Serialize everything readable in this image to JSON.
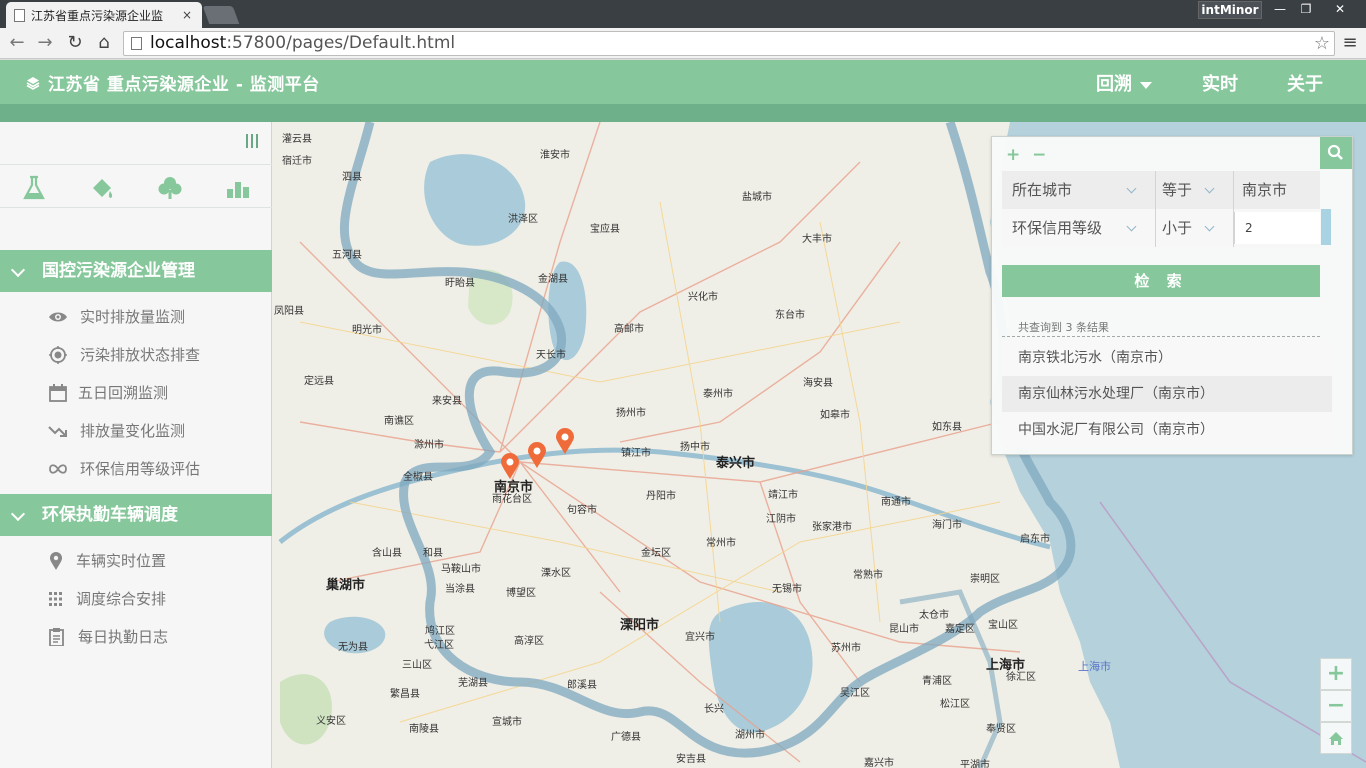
{
  "browser": {
    "tab_title": "江苏省重点污染源企业监",
    "tab_close": "×",
    "user_badge": "intMinor",
    "win_min": "—",
    "win_max": "❐",
    "win_close": "✕",
    "url_host": "localhost",
    "url_path": ":57800/pages/Default.html",
    "star": "☆",
    "menu": "≡",
    "back": "←",
    "forward": "→",
    "reload": "↻",
    "home": "⌂"
  },
  "header": {
    "brand": "江苏省 重点污染源企业 - 监测平台",
    "nav": {
      "huisu": "回溯",
      "shishi": "实时",
      "guanyu": "关于"
    }
  },
  "sidebar": {
    "sections": [
      {
        "title": "国控污染源企业管理",
        "items": [
          {
            "label": "实时排放量监测",
            "icon": "eye-icon"
          },
          {
            "label": "污染排放状态排查",
            "icon": "target-icon"
          },
          {
            "label": "五日回溯监测",
            "icon": "calendar-icon"
          },
          {
            "label": "排放量变化监测",
            "icon": "trend-down-icon"
          },
          {
            "label": "环保信用等级评估",
            "icon": "infinity-icon"
          }
        ]
      },
      {
        "title": "环保执勤车辆调度",
        "items": [
          {
            "label": "车辆实时位置",
            "icon": "map-pin-icon"
          },
          {
            "label": "调度综合安排",
            "icon": "grid-dots-icon"
          },
          {
            "label": "每日执勤日志",
            "icon": "clipboard-icon"
          }
        ]
      }
    ],
    "tools": [
      "flask-icon",
      "paint-bucket-icon",
      "tree-icon",
      "bar-chart-icon"
    ]
  },
  "query": {
    "plus": "+",
    "minus": "−",
    "rows": [
      {
        "field": "所在城市",
        "op": "等于",
        "value": "南京市"
      },
      {
        "field": "环保信用等级",
        "op": "小于",
        "value": "2"
      }
    ],
    "submit": "检 索",
    "count_text": "共查询到 3 条结果",
    "results": [
      "南京铁北污水（南京市）",
      "南京仙林污水处理厂（南京市）",
      "中国水泥厂有限公司（南京市）"
    ]
  },
  "map_controls": {
    "zoom_in": "+",
    "zoom_out": "−"
  },
  "map": {
    "labels": [
      "宿迁市",
      "灌云县",
      "淮安市",
      "盐城市",
      "泗县",
      "洪泽区",
      "宝应县",
      "大丰市",
      "五河县",
      "盱眙县",
      "金湖县",
      "兴化市",
      "东台市",
      "凤阳县",
      "明光市",
      "高邮市",
      "天长市",
      "定远县",
      "来安县",
      "泰州市",
      "海安县",
      "扬州市",
      "如皋市",
      "南谯区",
      "滁州市",
      "镇江市",
      "扬中市",
      "泰兴市",
      "如东县",
      "全椒县",
      "南京市",
      "雨花台区",
      "丹阳市",
      "靖江市",
      "南通市",
      "句容市",
      "江阴市",
      "张家港市",
      "海门市",
      "启东市",
      "含山县",
      "和县",
      "金坛区",
      "常州市",
      "常熟市",
      "崇明区",
      "巢湖市",
      "马鞍山市",
      "当涂县",
      "溧水区",
      "博望区",
      "无锡市",
      "太仓市",
      "宝山区",
      "鸠江区",
      "弋江区",
      "高淳区",
      "溧阳市",
      "宜兴市",
      "苏州市",
      "昆山市",
      "嘉定区",
      "上海市",
      "无为县",
      "三山区",
      "芜湖县",
      "郎溪县",
      "青浦区",
      "徐汇区",
      "繁昌县",
      "宣城市",
      "长兴",
      "吴江区",
      "松江区",
      "义安区",
      "南陵县",
      "广德县",
      "湖州市",
      "奉贤区",
      "安吉县",
      "嘉兴市",
      "平湖市"
    ]
  }
}
